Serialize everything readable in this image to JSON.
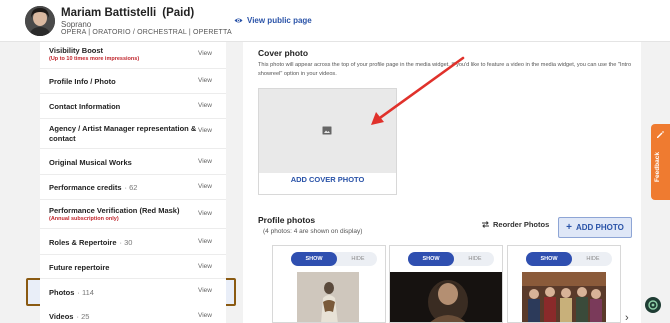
{
  "header": {
    "name": "Mariam Battistelli",
    "status": "(Paid)",
    "voice_type": "Soprano",
    "genres": "OPERA | ORATORIO / ORCHESTRAL | OPERETTA",
    "public_link_label": "View public page",
    "icon": "eye-icon"
  },
  "sidebar": {
    "view_label": "View",
    "items": [
      {
        "label": "Visibility Boost",
        "sub": "(Up to 10 times more impressions)",
        "count": ""
      },
      {
        "label": "Profile Info / Photo",
        "sub": "",
        "count": ""
      },
      {
        "label": "Contact Information",
        "sub": "",
        "count": ""
      },
      {
        "label": "Agency / Artist Manager representation & contact",
        "sub": "",
        "count": ""
      },
      {
        "label": "Original Musical Works",
        "sub": "",
        "count": ""
      },
      {
        "label": "Performance credits",
        "sub": "",
        "count": "62"
      },
      {
        "label": "Performance Verification (Red Mask)",
        "sub": "(Annual subscription only)",
        "count": ""
      },
      {
        "label": "Roles & Repertoire",
        "sub": "",
        "count": "30"
      },
      {
        "label": "Future repertoire",
        "sub": "",
        "count": ""
      },
      {
        "label": "Photos",
        "sub": "",
        "count": "114"
      },
      {
        "label": "Videos",
        "sub": "",
        "count": "25"
      }
    ]
  },
  "cover": {
    "title": "Cover photo",
    "description": "This photo will appear across the top of your profile page in the media widget. If you'd like to feature a video in the media widget, you can use the \"Intro showreel\" option in your videos.",
    "button": "ADD COVER PHOTO",
    "placeholder_icon": "image-icon"
  },
  "profile_photos": {
    "title": "Profile photos",
    "subtitle": "(4 photos: 4 are shown on display)",
    "reorder_label": "Reorder Photos",
    "add_label": "ADD PHOTO",
    "show_label": "SHOW",
    "hide_label": "HIDE"
  },
  "feedback_label": "Feedback",
  "colors": {
    "accent": "#2a53a8",
    "show_toggle": "#2f4fb0",
    "highlight_border": "#8a5a12",
    "arrow": "#e0312b",
    "feedback": "#ef7b30",
    "warning_text": "#c0262d"
  }
}
